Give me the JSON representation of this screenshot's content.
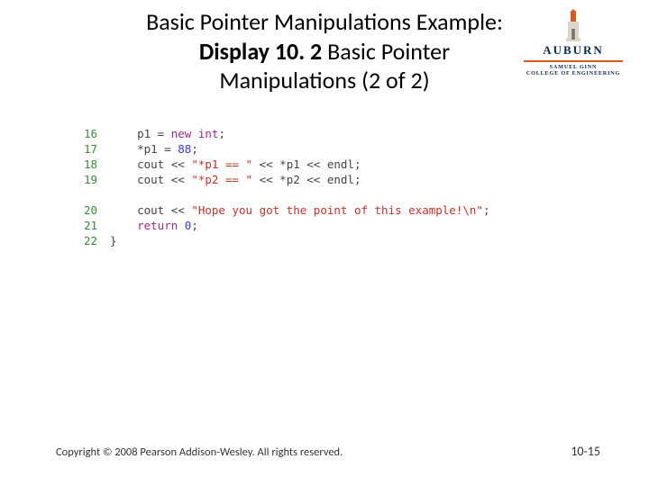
{
  "header": {
    "title_line1": "Basic Pointer Manipulations Example:",
    "title_bold": "Display 10. 2",
    "title_tail": "  Basic Pointer",
    "title_line3": "Manipulations (2 of 2)"
  },
  "logo": {
    "word": "AUBURN",
    "sub": "SAMUEL GINN",
    "sub2": "COLLEGE OF ENGINEERING"
  },
  "code": {
    "lines": [
      {
        "n": "16",
        "tokens": [
          [
            "p1 = ",
            "pl"
          ],
          [
            "new",
            "kw"
          ],
          [
            " ",
            "pl"
          ],
          [
            "int",
            "kw"
          ],
          [
            ";",
            "pl"
          ]
        ]
      },
      {
        "n": "17",
        "tokens": [
          [
            "*p1 = ",
            "pl"
          ],
          [
            "88",
            "num"
          ],
          [
            ";",
            "pl"
          ]
        ]
      },
      {
        "n": "18",
        "tokens": [
          [
            "cout << ",
            "pl"
          ],
          [
            "\"*p1 == \"",
            "str"
          ],
          [
            " << *p1 << endl;",
            "pl"
          ]
        ]
      },
      {
        "n": "19",
        "tokens": [
          [
            "cout << ",
            "pl"
          ],
          [
            "\"*p2 == \"",
            "str"
          ],
          [
            " << *p2 << endl;",
            "pl"
          ]
        ]
      }
    ],
    "lines2": [
      {
        "n": "20",
        "tokens": [
          [
            "cout << ",
            "pl"
          ],
          [
            "\"Hope you got the point of this example!\\n\"",
            "str"
          ],
          [
            ";",
            "pl"
          ]
        ]
      },
      {
        "n": "21",
        "tokens": [
          [
            "return",
            "kw"
          ],
          [
            " ",
            "pl"
          ],
          [
            "0",
            "num"
          ],
          [
            ";",
            "pl"
          ]
        ]
      },
      {
        "n": "22",
        "tokens": [
          [
            "}",
            "pl"
          ]
        ],
        "outdent": true
      }
    ]
  },
  "footer": {
    "copyright": "Copyright © 2008 Pearson Addison-Wesley. All rights reserved.",
    "page": "10-15"
  }
}
